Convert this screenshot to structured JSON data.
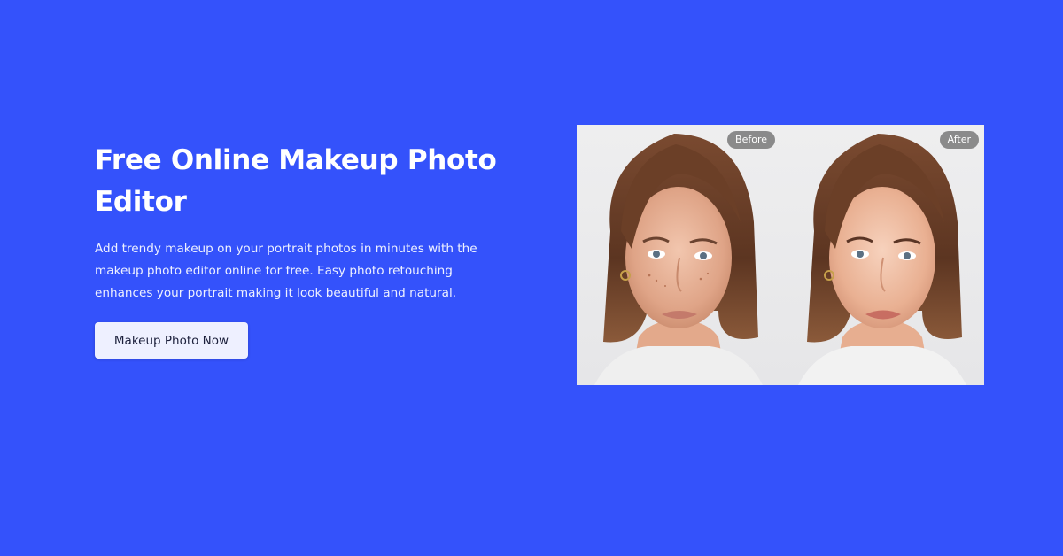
{
  "hero": {
    "title": "Free Online Makeup Photo Editor",
    "description": "Add trendy makeup on your portrait photos in minutes with the makeup photo editor online for free. Easy photo retouching enhances your portrait making it look beautiful and natural.",
    "cta_label": "Makeup Photo Now"
  },
  "comparison": {
    "before_label": "Before",
    "after_label": "After"
  },
  "colors": {
    "background": "#3452fb",
    "button_bg": "#eef0ff",
    "badge_bg": "#6e6e6e"
  }
}
